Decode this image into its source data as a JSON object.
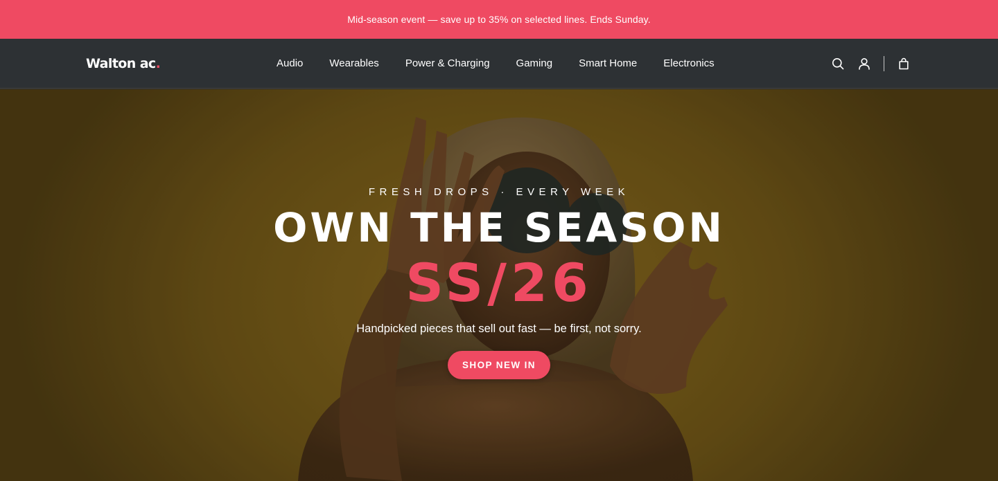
{
  "announcement": {
    "text": "Mid-season event — save up to 35% on selected lines. Ends Sunday."
  },
  "header": {
    "logo_text": "Walton ac",
    "logo_dot": ".",
    "nav": [
      {
        "label": "Audio"
      },
      {
        "label": "Wearables"
      },
      {
        "label": "Power & Charging"
      },
      {
        "label": "Gaming"
      },
      {
        "label": "Smart Home"
      },
      {
        "label": "Electronics"
      }
    ],
    "icons": [
      "search-icon",
      "account-icon",
      "cart-bag-icon"
    ]
  },
  "hero": {
    "eyebrow": "FRESH DROPS · EVERY WEEK",
    "headline": "OWN THE SEASON",
    "season": "SS/26",
    "subtext": "Handpicked pieces that sell out fast — be first, not sorry.",
    "cta_label": "SHOP NEW IN"
  },
  "colors": {
    "accent": "#ef4a62",
    "header_bg": "#2d3134",
    "hero_tint": "#7a5e1a",
    "text_light": "#ffffff"
  }
}
